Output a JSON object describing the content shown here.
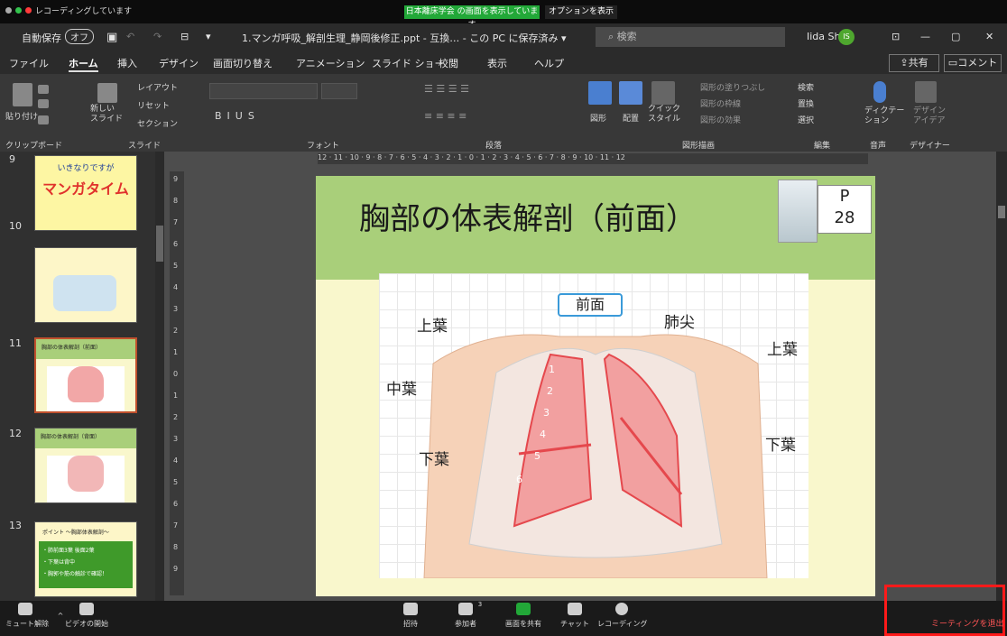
{
  "zoom_top": {
    "recording_status": "レコーディングしています",
    "share_notice": "日本離床学会 の画面を表示しています",
    "options_label": "オプションを表示 ⌄"
  },
  "titlebar": {
    "autosave_label": "自動保存",
    "autosave_state": "オフ",
    "doc_title": "1.マンガ呼吸_解剖生理_静岡後修正.ppt - 互換… - この PC に保存済み ▾",
    "search_placeholder": "検索",
    "user_name": "Iida Sho",
    "user_initials": "IS"
  },
  "menu": {
    "tabs": [
      "ファイル",
      "ホーム",
      "挿入",
      "デザイン",
      "画面切り替え",
      "アニメーション",
      "スライド ショー",
      "校閲",
      "表示",
      "ヘルプ"
    ],
    "share": "共有",
    "comment": "コメント"
  },
  "ribbon": {
    "paste": "貼り付け",
    "new_slide": "新しい\nスライド",
    "layout": "レイアウト",
    "reset": "リセット",
    "section": "セクション",
    "shape": "図形",
    "arrange": "配置",
    "quick_style": "クイック\nスタイル",
    "shape_fill": "図形の塗りつぶし",
    "shape_outline": "図形の枠線",
    "shape_effect": "図形の効果",
    "find": "検索",
    "replace": "置換",
    "select": "選択",
    "dictate": "ディクテー\nション",
    "design_ideas": "デザイン\nアイデア",
    "groups": [
      "クリップボード",
      "スライド",
      "フォント",
      "段落",
      "図形描画",
      "編集",
      "音声",
      "デザイナー"
    ]
  },
  "thumbnails": [
    {
      "num": "9",
      "title": "いきなりですが",
      "big": "マンガタイム"
    },
    {
      "num": "10",
      "title": ""
    },
    {
      "num": "11",
      "title": "胸部の体表解剖（前面）"
    },
    {
      "num": "12",
      "title": "胸部の体表解剖（背面）"
    },
    {
      "num": "13",
      "title": "ポイント ～胸部体表解剖～",
      "lines": [
        "・肺前面3葉 後面2葉",
        "・下葉は背中",
        "・胸郭や筋の触診で確認！"
      ]
    }
  ],
  "ruler_h": "12 · 11 · 10 · 9 · 8 · 7 · 6 · 5 · 4 · 3 · 2 · 1 · 0 · 1 · 2 · 3 · 4 · 5 · 6 · 7 · 8 · 9 · 10 · 11 · 12",
  "slide": {
    "title": "胸部の体表解剖（前面）",
    "page_prefix": "P",
    "page_number": "28",
    "figure_label": "前面",
    "labels": {
      "upper_left": "上葉",
      "apex": "肺尖",
      "upper_right": "上葉",
      "middle": "中葉",
      "lower_left": "下葉",
      "lower_right": "下葉"
    },
    "rib_numbers": [
      "1",
      "2",
      "3",
      "4",
      "5",
      "6"
    ]
  },
  "zoom_bottom": {
    "mute": "ミュート解除",
    "video": "ビデオの開始",
    "invite": "招待",
    "participants": "参加者",
    "participants_count": "3",
    "share_screen": "画面を共有",
    "chat": "チャット",
    "record": "レコーディング",
    "leave": "ミーティングを退出"
  },
  "colors": {
    "share_green": "#22a838",
    "slide_header_green": "#a9cf7a",
    "slide_bg": "#f9f7cc",
    "leave_red": "#ff1a1a",
    "lung_red": "#e5484d"
  }
}
